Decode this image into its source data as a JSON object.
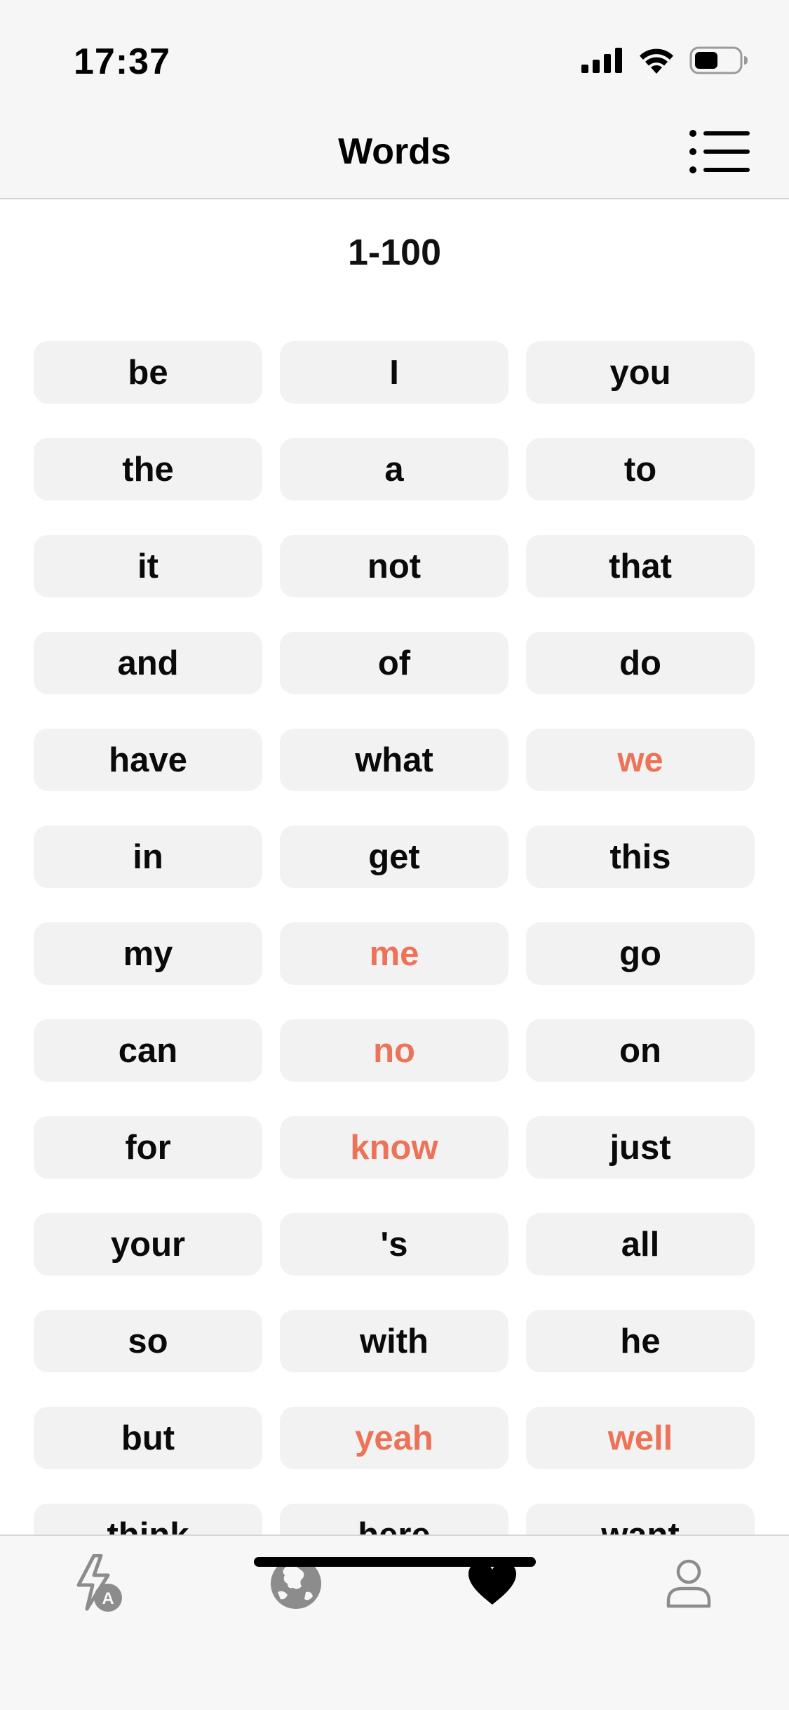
{
  "status_bar": {
    "time": "17:37",
    "icons": [
      "cellular-signal-icon",
      "wifi-icon",
      "battery-icon"
    ]
  },
  "nav": {
    "title": "Words",
    "menu_icon": "list-icon"
  },
  "section": {
    "title": "1-100"
  },
  "colors": {
    "highlight": "#ec7358",
    "normal": "#0a0a0a",
    "button_bg": "#f2f2f2"
  },
  "words": [
    {
      "text": "be",
      "highlighted": false
    },
    {
      "text": "I",
      "highlighted": false
    },
    {
      "text": "you",
      "highlighted": false
    },
    {
      "text": "the",
      "highlighted": false
    },
    {
      "text": "a",
      "highlighted": false
    },
    {
      "text": "to",
      "highlighted": false
    },
    {
      "text": "it",
      "highlighted": false
    },
    {
      "text": "not",
      "highlighted": false
    },
    {
      "text": "that",
      "highlighted": false
    },
    {
      "text": "and",
      "highlighted": false
    },
    {
      "text": "of",
      "highlighted": false
    },
    {
      "text": "do",
      "highlighted": false
    },
    {
      "text": "have",
      "highlighted": false
    },
    {
      "text": "what",
      "highlighted": false
    },
    {
      "text": "we",
      "highlighted": true
    },
    {
      "text": "in",
      "highlighted": false
    },
    {
      "text": "get",
      "highlighted": false
    },
    {
      "text": "this",
      "highlighted": false
    },
    {
      "text": "my",
      "highlighted": false
    },
    {
      "text": "me",
      "highlighted": true
    },
    {
      "text": "go",
      "highlighted": false
    },
    {
      "text": "can",
      "highlighted": false
    },
    {
      "text": "no",
      "highlighted": true
    },
    {
      "text": "on",
      "highlighted": false
    },
    {
      "text": "for",
      "highlighted": false
    },
    {
      "text": "know",
      "highlighted": true
    },
    {
      "text": "just",
      "highlighted": false
    },
    {
      "text": "your",
      "highlighted": false
    },
    {
      "text": "'s",
      "highlighted": false
    },
    {
      "text": "all",
      "highlighted": false
    },
    {
      "text": "so",
      "highlighted": false
    },
    {
      "text": "with",
      "highlighted": false
    },
    {
      "text": "he",
      "highlighted": false
    },
    {
      "text": "but",
      "highlighted": false
    },
    {
      "text": "yeah",
      "highlighted": true
    },
    {
      "text": "well",
      "highlighted": true
    },
    {
      "text": "think",
      "highlighted": false
    },
    {
      "text": "here",
      "highlighted": false
    },
    {
      "text": "want",
      "highlighted": false
    }
  ],
  "tab_bar": {
    "tabs": [
      {
        "icon": "flash-translate-icon",
        "active": false
      },
      {
        "icon": "globe-icon",
        "active": false
      },
      {
        "icon": "heart-icon",
        "active": true
      },
      {
        "icon": "person-icon",
        "active": false
      }
    ]
  }
}
